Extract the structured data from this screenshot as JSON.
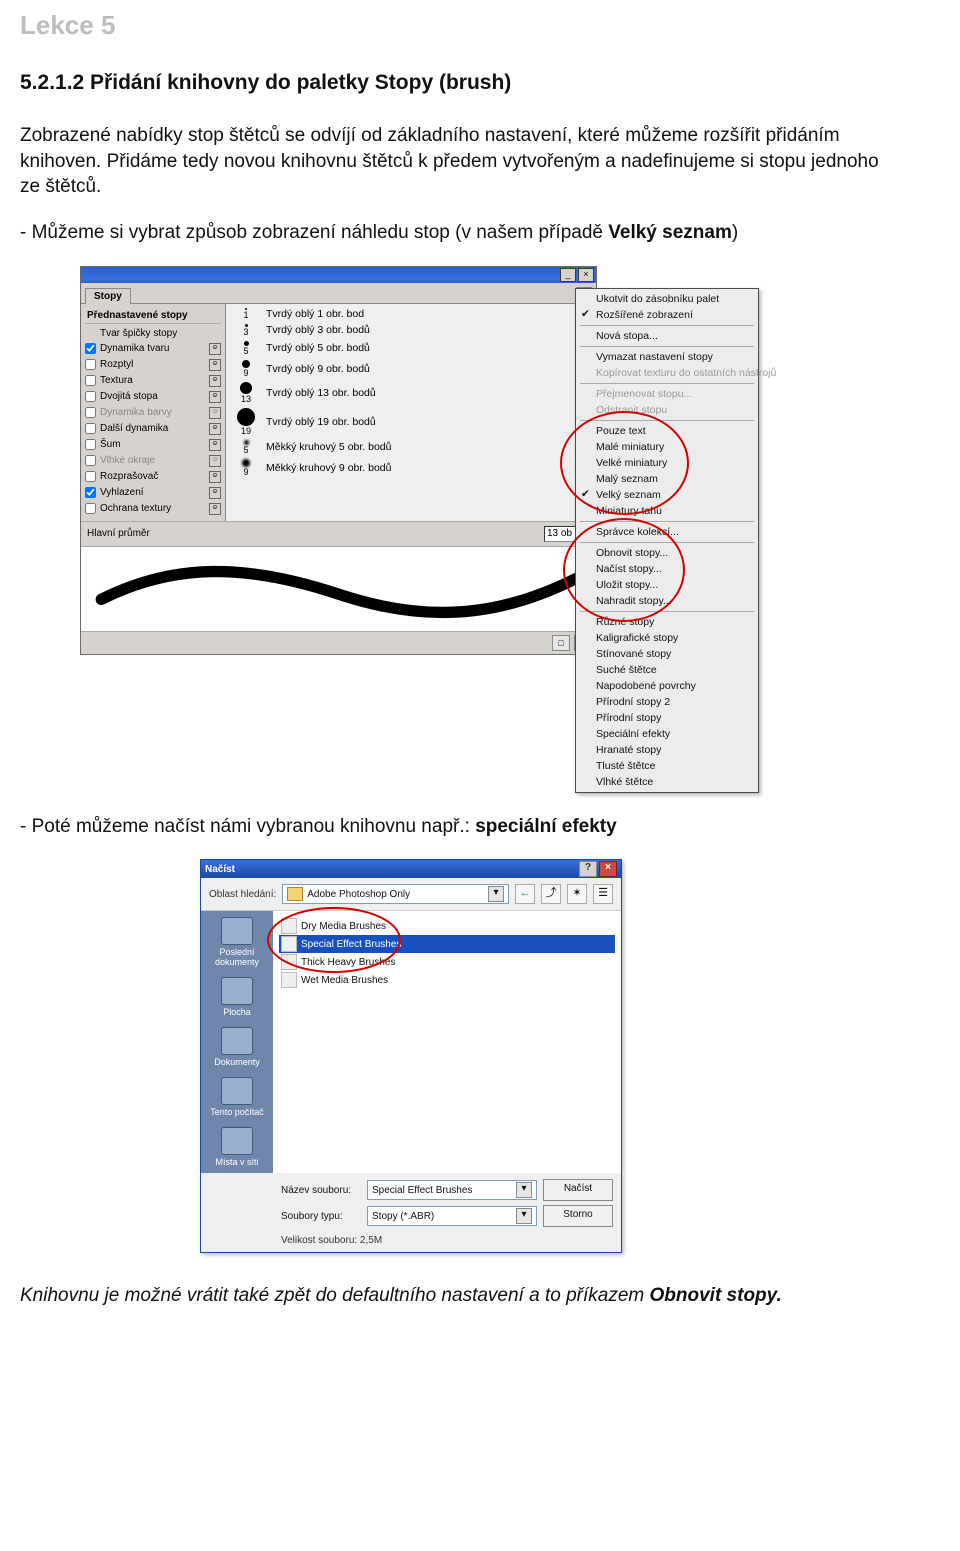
{
  "lesson_header": "Lekce 5",
  "section_title": "5.2.1.2 Přidání knihovny do paletky Stopy (brush)",
  "para1": "Zobrazené nabídky stop štětců se odvíjí od základního nastavení, které můžeme rozšířit přidáním knihoven. Přidáme tedy novou knihovnu štětců k předem vytvořeným a nadefinujeme si stopu jednoho ze štětců.",
  "para2_prefix": "- Můžeme si vybrat způsob zobrazení náhledu stop (v našem případě ",
  "para2_bold": "Velký seznam",
  "para2_suffix": ")",
  "para3_prefix": "- Poté můžeme načíst námi vybranou knihovnu např.: ",
  "para3_bold": "speciální efekty",
  "para4_prefix": "Knihovnu je možné vrátit také zpět do defaultního nastavení a to příkazem ",
  "para4_bold": "Obnovit stopy.",
  "palette": {
    "tab": "Stopy",
    "preset_header": "Přednastavené stopy",
    "preset_rows": [
      {
        "label": "Tvar špičky stopy",
        "checkbox": false,
        "checked": false,
        "disabled": false,
        "lock": false
      },
      {
        "label": "Dynamika tvaru",
        "checkbox": true,
        "checked": true,
        "disabled": false,
        "lock": true
      },
      {
        "label": "Rozptyl",
        "checkbox": true,
        "checked": false,
        "disabled": false,
        "lock": true
      },
      {
        "label": "Textura",
        "checkbox": true,
        "checked": false,
        "disabled": false,
        "lock": true
      },
      {
        "label": "Dvojitá stopa",
        "checkbox": true,
        "checked": false,
        "disabled": false,
        "lock": true
      },
      {
        "label": "Dynamika barvy",
        "checkbox": true,
        "checked": false,
        "disabled": true,
        "lock": true
      },
      {
        "label": "Další dynamika",
        "checkbox": true,
        "checked": false,
        "disabled": false,
        "lock": true
      },
      {
        "label": "Šum",
        "checkbox": true,
        "checked": false,
        "disabled": false,
        "lock": true
      },
      {
        "label": "Vlhké okraje",
        "checkbox": true,
        "checked": false,
        "disabled": true,
        "lock": true
      },
      {
        "label": "Rozprašovač",
        "checkbox": true,
        "checked": false,
        "disabled": false,
        "lock": true
      },
      {
        "label": "Vyhlazení",
        "checkbox": true,
        "checked": true,
        "disabled": false,
        "lock": true
      },
      {
        "label": "Ochrana textury",
        "checkbox": true,
        "checked": false,
        "disabled": false,
        "lock": true
      }
    ],
    "brushes": [
      {
        "size": 1,
        "label": "Tvrdý oblý 1 obr. bod"
      },
      {
        "size": 3,
        "label": "Tvrdý oblý 3 obr. bodů"
      },
      {
        "size": 5,
        "label": "Tvrdý oblý 5 obr. bodů"
      },
      {
        "size": 9,
        "label": "Tvrdý oblý 9 obr. bodů"
      },
      {
        "size": 13,
        "label": "Tvrdý oblý 13 obr. bodů"
      },
      {
        "size": 19,
        "label": "Tvrdý oblý 19 obr. bodů"
      },
      {
        "size": 5,
        "label": "Měkký kruhový 5 obr. bodů"
      },
      {
        "size": 9,
        "label": "Měkký kruhový 9 obr. bodů"
      }
    ],
    "footer_label": "Hlavní průměr",
    "footer_value": "13 ob"
  },
  "context_menu": {
    "groups": [
      [
        {
          "label": "Ukotvit do zásobníku palet",
          "checked": false,
          "disabled": false
        },
        {
          "label": "Rozšířené zobrazení",
          "checked": true,
          "disabled": false
        }
      ],
      [
        {
          "label": "Nová stopa...",
          "checked": false,
          "disabled": false
        }
      ],
      [
        {
          "label": "Vymazat nastavení stopy",
          "checked": false,
          "disabled": false
        },
        {
          "label": "Kopírovat texturu do ostatních nástrojů",
          "checked": false,
          "disabled": true
        }
      ],
      [
        {
          "label": "Přejmenovat stopu...",
          "checked": false,
          "disabled": true
        },
        {
          "label": "Odstranit stopu",
          "checked": false,
          "disabled": true
        }
      ],
      [
        {
          "label": "Pouze text",
          "checked": false,
          "disabled": false
        },
        {
          "label": "Malé miniatury",
          "checked": false,
          "disabled": false
        },
        {
          "label": "Velké miniatury",
          "checked": false,
          "disabled": false
        },
        {
          "label": "Malý seznam",
          "checked": false,
          "disabled": false
        },
        {
          "label": "Velký seznam",
          "checked": true,
          "disabled": false
        },
        {
          "label": "Miniatury tahu",
          "checked": false,
          "disabled": false
        }
      ],
      [
        {
          "label": "Správce kolekcí...",
          "checked": false,
          "disabled": false
        }
      ],
      [
        {
          "label": "Obnovit stopy...",
          "checked": false,
          "disabled": false
        },
        {
          "label": "Načíst stopy...",
          "checked": false,
          "disabled": false
        },
        {
          "label": "Uložit stopy...",
          "checked": false,
          "disabled": false
        },
        {
          "label": "Nahradit stopy...",
          "checked": false,
          "disabled": false
        }
      ],
      [
        {
          "label": "Různé stopy",
          "checked": false,
          "disabled": false
        },
        {
          "label": "Kaligrafické stopy",
          "checked": false,
          "disabled": false
        },
        {
          "label": "Stínované stopy",
          "checked": false,
          "disabled": false
        },
        {
          "label": "Suché štětce",
          "checked": false,
          "disabled": false
        },
        {
          "label": "Napodobené povrchy",
          "checked": false,
          "disabled": false
        },
        {
          "label": "Přírodní stopy 2",
          "checked": false,
          "disabled": false
        },
        {
          "label": "Přírodní stopy",
          "checked": false,
          "disabled": false
        },
        {
          "label": "Speciální efekty",
          "checked": false,
          "disabled": false
        },
        {
          "label": "Hranaté stopy",
          "checked": false,
          "disabled": false
        },
        {
          "label": "Tlusté štětce",
          "checked": false,
          "disabled": false
        },
        {
          "label": "Vlhké štětce",
          "checked": false,
          "disabled": false
        }
      ]
    ]
  },
  "dialog": {
    "title": "Načíst",
    "lookin_label": "Oblast hledání:",
    "lookin_value": "Adobe Photoshop Only",
    "places": [
      "Poslední dokumenty",
      "Plocha",
      "Dokumenty",
      "Tento počítač",
      "Místa v síti"
    ],
    "files": [
      {
        "name": "Dry Media Brushes",
        "selected": false
      },
      {
        "name": "Special Effect Brushes",
        "selected": true
      },
      {
        "name": "Thick Heavy Brushes",
        "selected": false
      },
      {
        "name": "Wet Media Brushes",
        "selected": false
      }
    ],
    "filename_label": "Název souboru:",
    "filename_value": "Special Effect Brushes",
    "filetype_label": "Soubory typu:",
    "filetype_value": "Stopy (*.ABR)",
    "btn_open": "Načíst",
    "btn_cancel": "Storno",
    "filesize_label": "Velikost souboru: 2,5M"
  }
}
